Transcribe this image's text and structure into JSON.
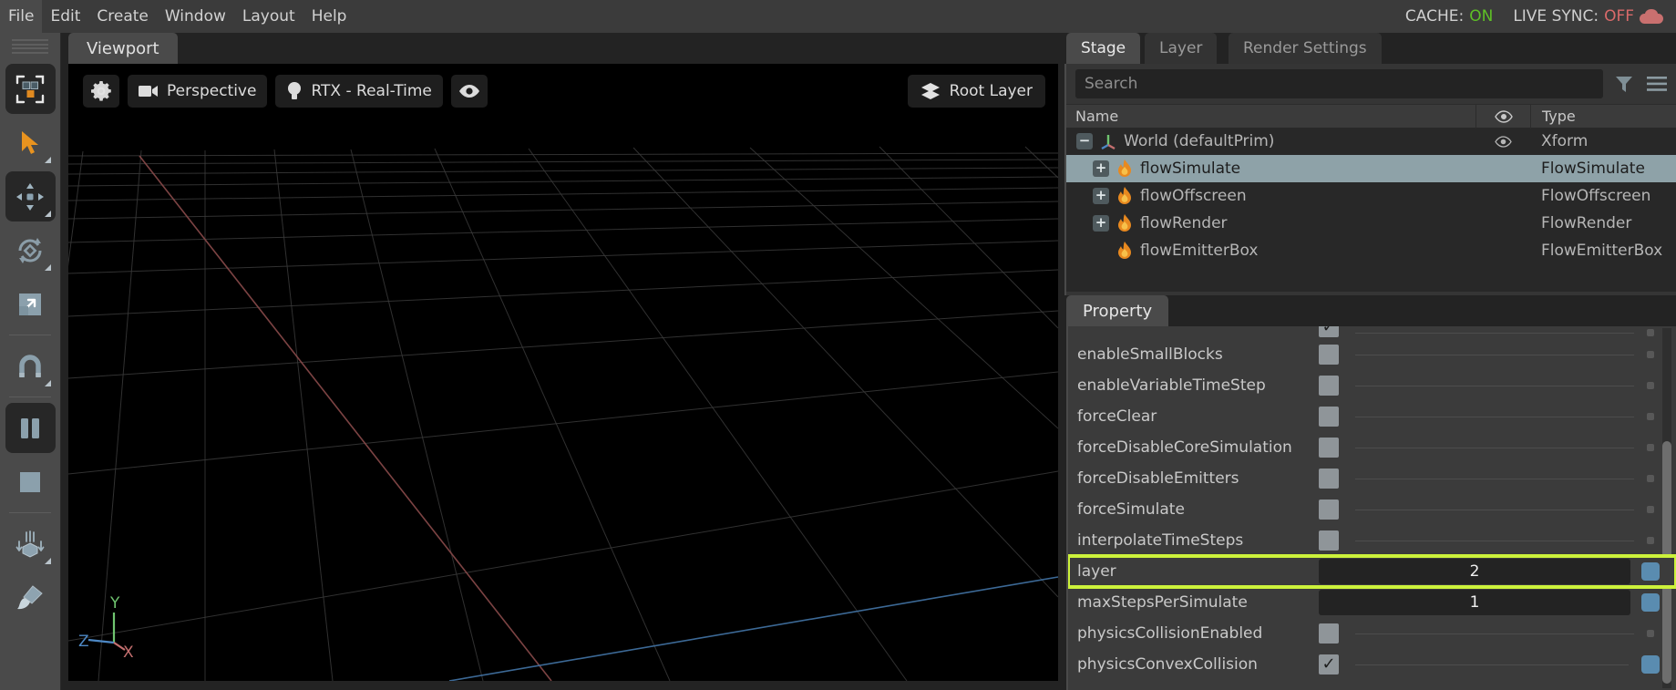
{
  "menubar": {
    "items": [
      "File",
      "Edit",
      "Create",
      "Window",
      "Layout",
      "Help"
    ],
    "cache_label": "CACHE:",
    "cache_value": "ON",
    "livesync_label": "LIVE SYNC:",
    "livesync_value": "OFF",
    "cache_on_color": "#5ec026",
    "livesync_off_color": "#d96a6a"
  },
  "left_toolbar": {
    "tools": [
      {
        "name": "select-mode-button",
        "icon": "select-boxes-icon",
        "active": true,
        "submenu": false
      },
      {
        "name": "select-tool-button",
        "icon": "arrow-cursor-icon",
        "active": false,
        "submenu": true
      },
      {
        "name": "move-tool-button",
        "icon": "move-arrows-icon",
        "active": true,
        "submenu": true
      },
      {
        "name": "rotate-tool-button",
        "icon": "rotate-icon",
        "active": false,
        "submenu": true
      },
      {
        "name": "scale-tool-button",
        "icon": "scale-icon",
        "active": false,
        "submenu": false
      },
      {
        "name": "snap-tool-button",
        "icon": "magnet-icon",
        "active": false,
        "submenu": true
      },
      {
        "name": "play-pause-button",
        "icon": "pause-icon",
        "active": true,
        "submenu": false
      },
      {
        "name": "stop-button",
        "icon": "stop-square-icon",
        "active": false,
        "submenu": false
      },
      {
        "name": "physics-drop-button",
        "icon": "drop-object-icon",
        "active": false,
        "submenu": true
      },
      {
        "name": "paint-tool-button",
        "icon": "paintbrush-icon",
        "active": false,
        "submenu": false
      }
    ]
  },
  "viewport": {
    "tab_label": "Viewport",
    "settings_label": "",
    "camera_label": "Perspective",
    "renderer_label": "RTX - Real-Time",
    "visibility_label": "",
    "root_layer_label": "Root Layer",
    "axis": {
      "x": "X",
      "y": "Y",
      "z": "Z",
      "x_color": "#c46f6f",
      "y_color": "#6fc46f",
      "z_color": "#4d88c4"
    },
    "background": "#000000"
  },
  "stage_panel": {
    "tabs": [
      {
        "label": "Stage",
        "selected": true
      },
      {
        "label": "Layer",
        "selected": false
      },
      {
        "label": "Render Settings",
        "selected": false
      }
    ],
    "search_placeholder": "Search",
    "columns": {
      "name": "Name",
      "visibility": "",
      "type": "Type"
    },
    "rows": [
      {
        "name": "World (defaultPrim)",
        "type": "Xform",
        "depth": 0,
        "expander": "−",
        "icon": "xform-axis-icon",
        "eye": true,
        "selected": false
      },
      {
        "name": "flowSimulate",
        "type": "FlowSimulate",
        "depth": 1,
        "expander": "+",
        "icon": "flame-icon",
        "eye": false,
        "selected": true
      },
      {
        "name": "flowOffscreen",
        "type": "FlowOffscreen",
        "depth": 1,
        "expander": "+",
        "icon": "flame-icon",
        "eye": false,
        "selected": false
      },
      {
        "name": "flowRender",
        "type": "FlowRender",
        "depth": 1,
        "expander": "+",
        "icon": "flame-icon",
        "eye": false,
        "selected": false
      },
      {
        "name": "flowEmitterBox",
        "type": "FlowEmitterBox",
        "depth": 1,
        "expander": "",
        "icon": "flame-icon",
        "eye": false,
        "selected": false
      }
    ]
  },
  "property_panel": {
    "tab_label": "Property",
    "rows": [
      {
        "label": "",
        "kind": "checkbox",
        "checked": true,
        "partial": true,
        "highlight": false
      },
      {
        "label": "enableSmallBlocks",
        "kind": "checkbox",
        "checked": false,
        "highlight": false
      },
      {
        "label": "enableVariableTimeStep",
        "kind": "checkbox",
        "checked": false,
        "highlight": false
      },
      {
        "label": "forceClear",
        "kind": "checkbox",
        "checked": false,
        "highlight": false
      },
      {
        "label": "forceDisableCoreSimulation",
        "kind": "checkbox",
        "checked": false,
        "highlight": false
      },
      {
        "label": "forceDisableEmitters",
        "kind": "checkbox",
        "checked": false,
        "highlight": false
      },
      {
        "label": "forceSimulate",
        "kind": "checkbox",
        "checked": false,
        "highlight": false
      },
      {
        "label": "interpolateTimeSteps",
        "kind": "checkbox",
        "checked": false,
        "highlight": false
      },
      {
        "label": "layer",
        "kind": "number",
        "value": "2",
        "highlight": true
      },
      {
        "label": "maxStepsPerSimulate",
        "kind": "number",
        "value": "1",
        "highlight": false
      },
      {
        "label": "physicsCollisionEnabled",
        "kind": "checkbox",
        "checked": false,
        "highlight": false
      },
      {
        "label": "physicsConvexCollision",
        "kind": "checkbox",
        "checked": true,
        "highlight": false
      }
    ]
  },
  "colors": {
    "highlight_outline": "#ccf23b",
    "selection_row": "#8ea2a8",
    "panel_bg": "#3b3b3b",
    "accent_blue": "#5a8cb0"
  }
}
